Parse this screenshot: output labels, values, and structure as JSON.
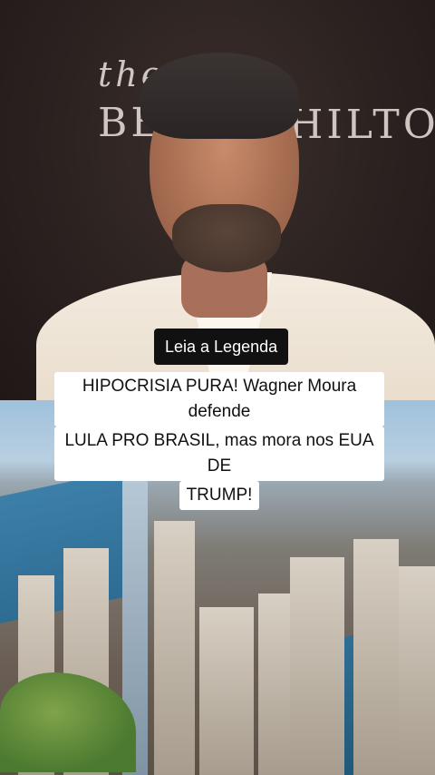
{
  "backdrop": {
    "text_the": "the",
    "text_b": "BE",
    "text_hilton": "HILTON"
  },
  "caption": {
    "badge": "Leia a Legenda",
    "line1": "HIPOCRISIA PURA! Wagner Moura defende",
    "line2": "LULA PRO BRASIL, mas mora nos EUA DE",
    "line3": "TRUMP!"
  },
  "colors": {
    "badge_bg": "#111111",
    "caption_bg": "#ffffff"
  }
}
